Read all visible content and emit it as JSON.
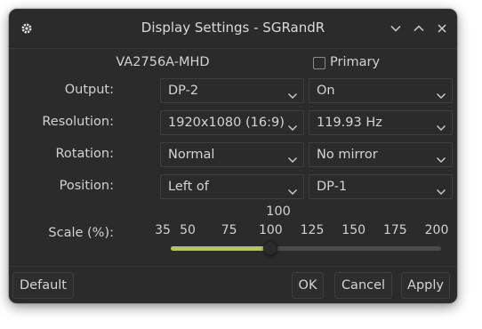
{
  "window": {
    "title": "Display Settings - SGRandR"
  },
  "monitor": {
    "name": "VA2756A-MHD",
    "primary_label": "Primary",
    "primary_checked": false
  },
  "rows": {
    "output": {
      "label": "Output:",
      "value": "DP-2",
      "state": "On"
    },
    "resolution": {
      "label": "Resolution:",
      "value": "1920x1080 (16:9)",
      "rate": "119.93 Hz"
    },
    "rotation": {
      "label": "Rotation:",
      "value": "Normal",
      "mirror": "No mirror"
    },
    "position": {
      "label": "Position:",
      "value": "Left of",
      "target": "DP-1"
    }
  },
  "scale": {
    "label": "Scale (%):",
    "current_label": "100",
    "value": 100,
    "min": 35,
    "max": 200,
    "ticks": [
      "35",
      "50",
      "75",
      "100",
      "125",
      "150",
      "175",
      "200"
    ]
  },
  "buttons": {
    "default": "Default",
    "ok": "OK",
    "cancel": "Cancel",
    "apply": "Apply"
  },
  "colors": {
    "window_bg": "#2b2b2b",
    "slider_fill": "#b7c458",
    "slider_track": "#4a4a4a"
  },
  "icons": {
    "app": "gear-icon",
    "minimize": "chevron-down-icon",
    "maximize": "chevron-up-icon",
    "close": "close-icon",
    "dropdown": "chevron-down-icon"
  }
}
